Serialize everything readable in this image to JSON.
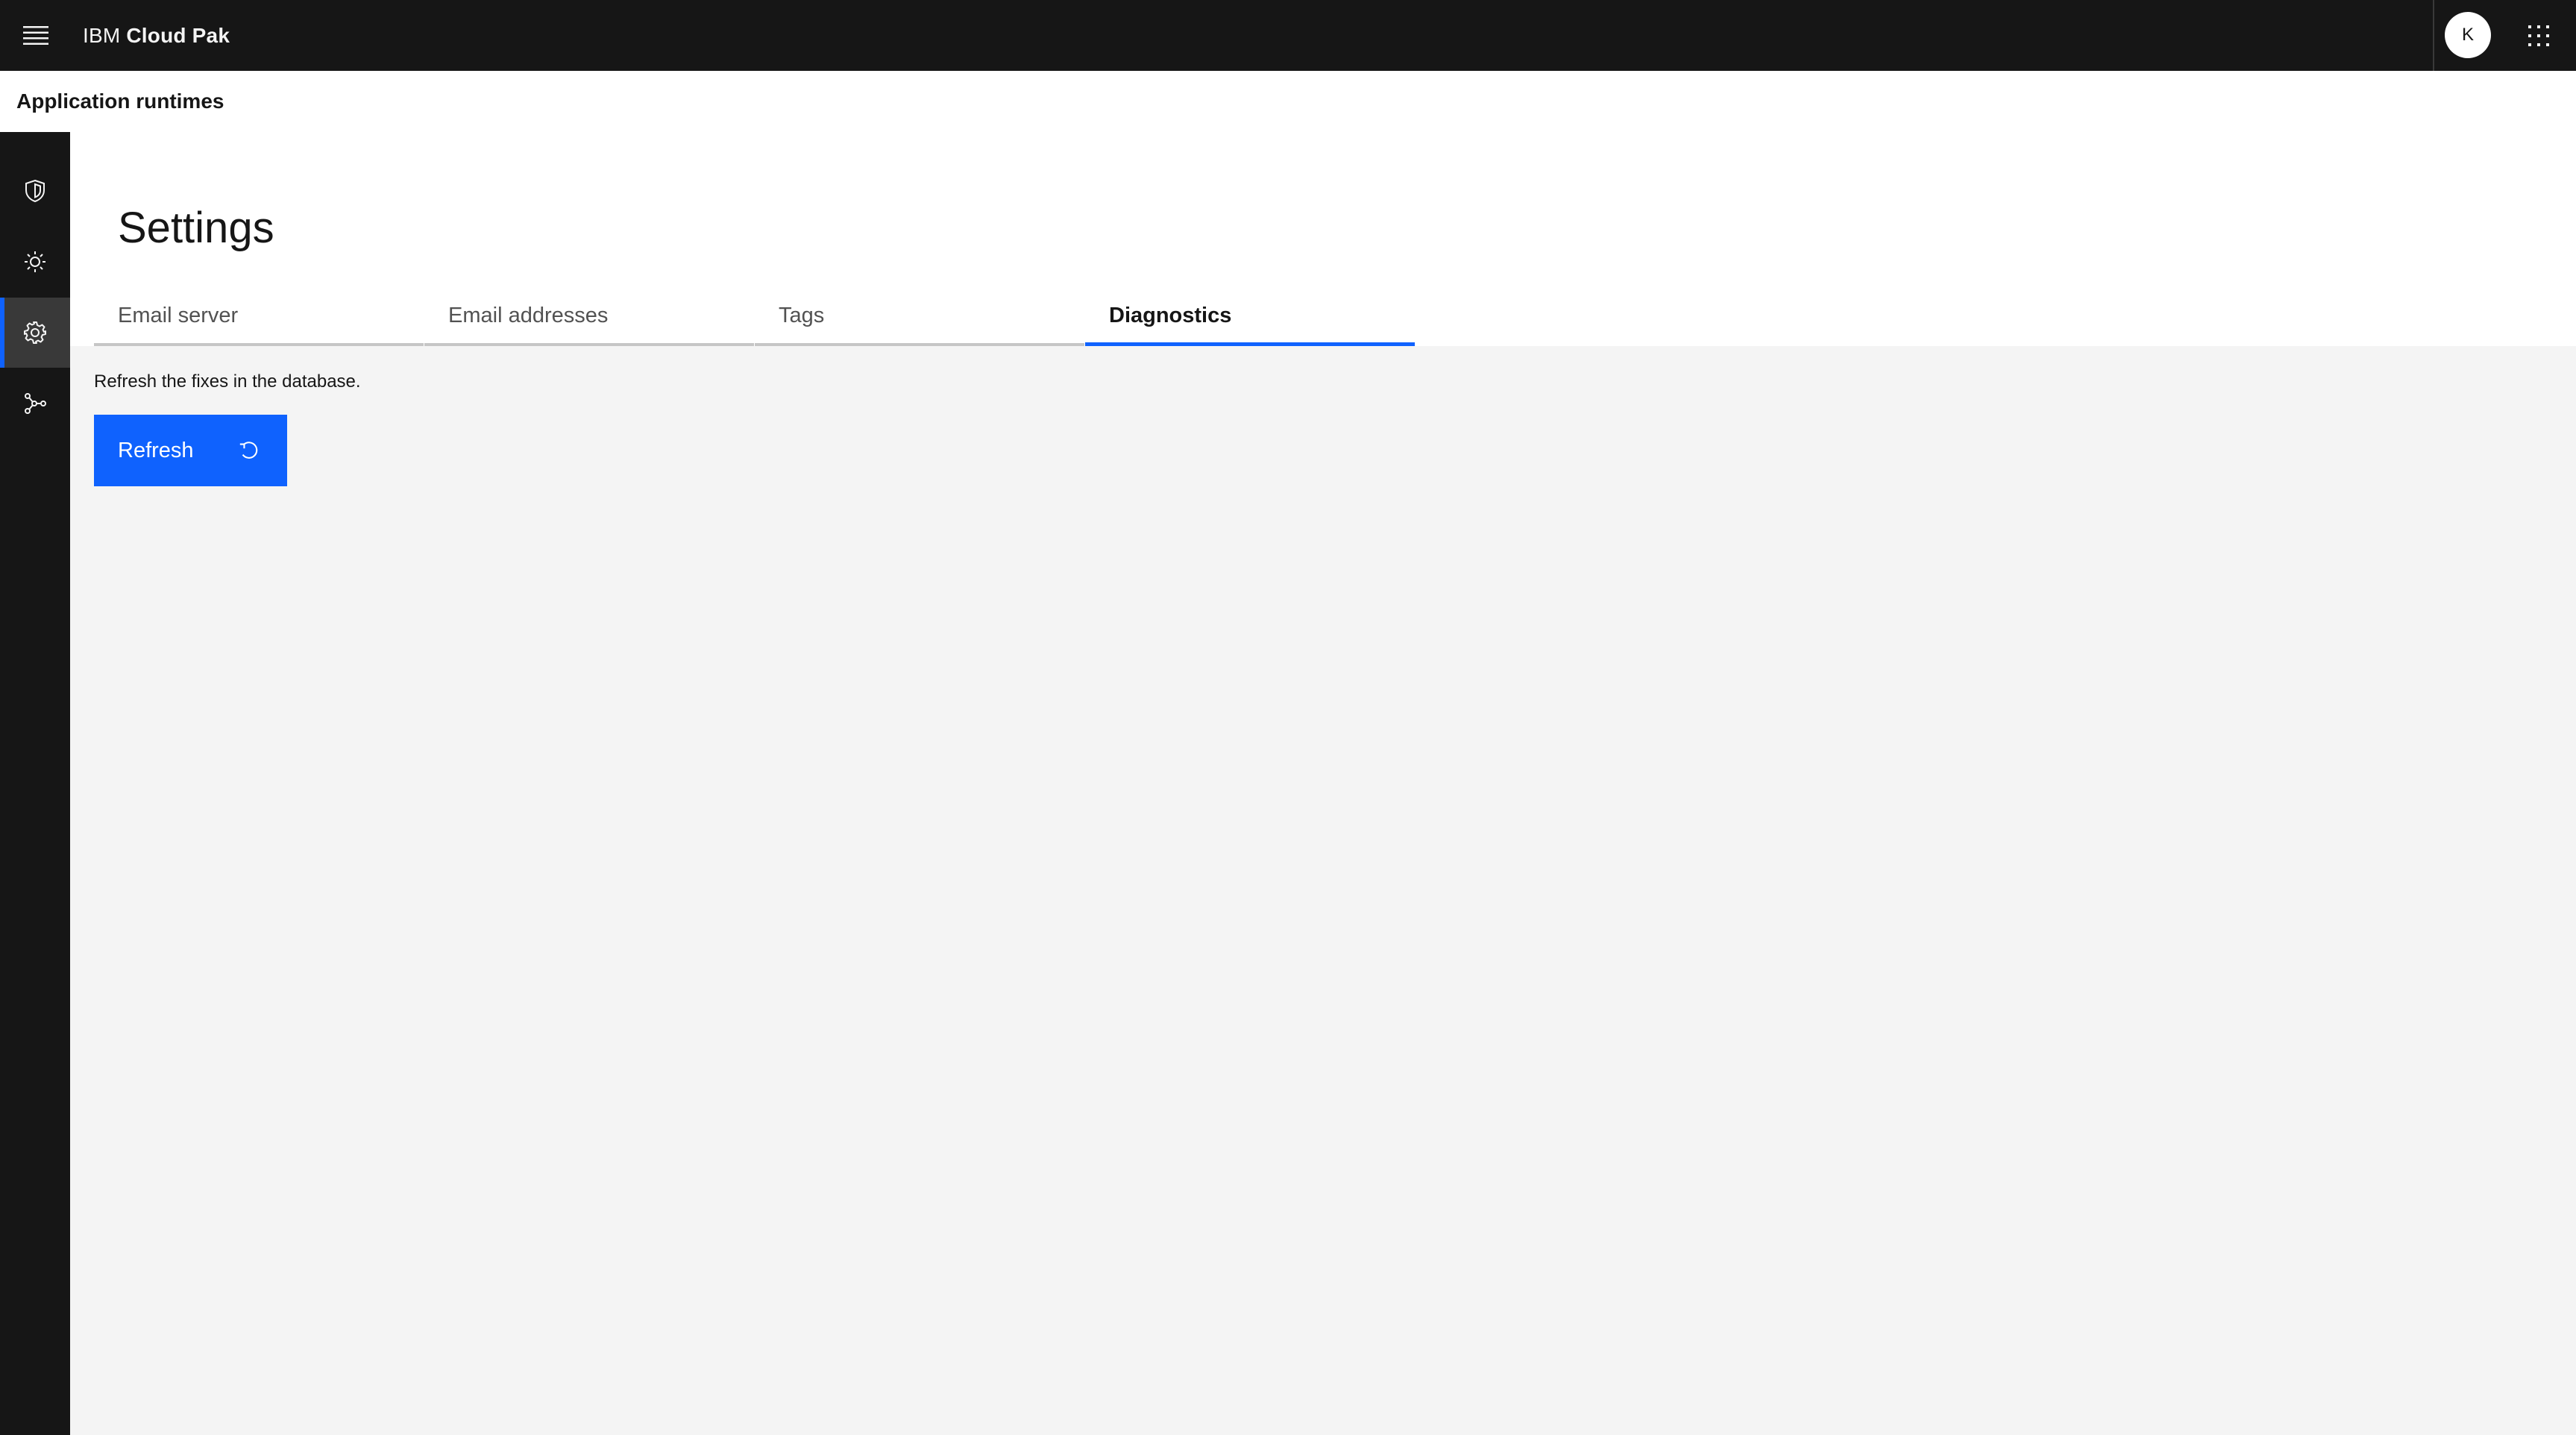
{
  "header": {
    "brand_prefix": "IBM",
    "brand_name": "Cloud Pak",
    "avatar_initial": "K",
    "menu_icon": "hamburger-menu-icon",
    "switcher_icon": "app-switcher-icon"
  },
  "subheader": {
    "product_name": "Application runtimes"
  },
  "sidenav": {
    "items": [
      {
        "name": "security",
        "icon": "shield-icon",
        "active": false
      },
      {
        "name": "insights",
        "icon": "sun-icon",
        "active": false
      },
      {
        "name": "settings",
        "icon": "gear-icon",
        "active": true
      },
      {
        "name": "network",
        "icon": "network-icon",
        "active": false
      }
    ]
  },
  "main": {
    "title": "Settings",
    "tabs": [
      {
        "label": "Email server",
        "active": false
      },
      {
        "label": "Email addresses",
        "active": false
      },
      {
        "label": "Tags",
        "active": false
      },
      {
        "label": "Diagnostics",
        "active": true
      }
    ],
    "diagnostics": {
      "description": "Refresh the fixes in the database.",
      "refresh_label": "Refresh",
      "refresh_icon": "refresh-icon"
    }
  },
  "colors": {
    "header_bg": "#161616",
    "accent": "#0f62fe",
    "page_bg": "#f4f4f4"
  }
}
